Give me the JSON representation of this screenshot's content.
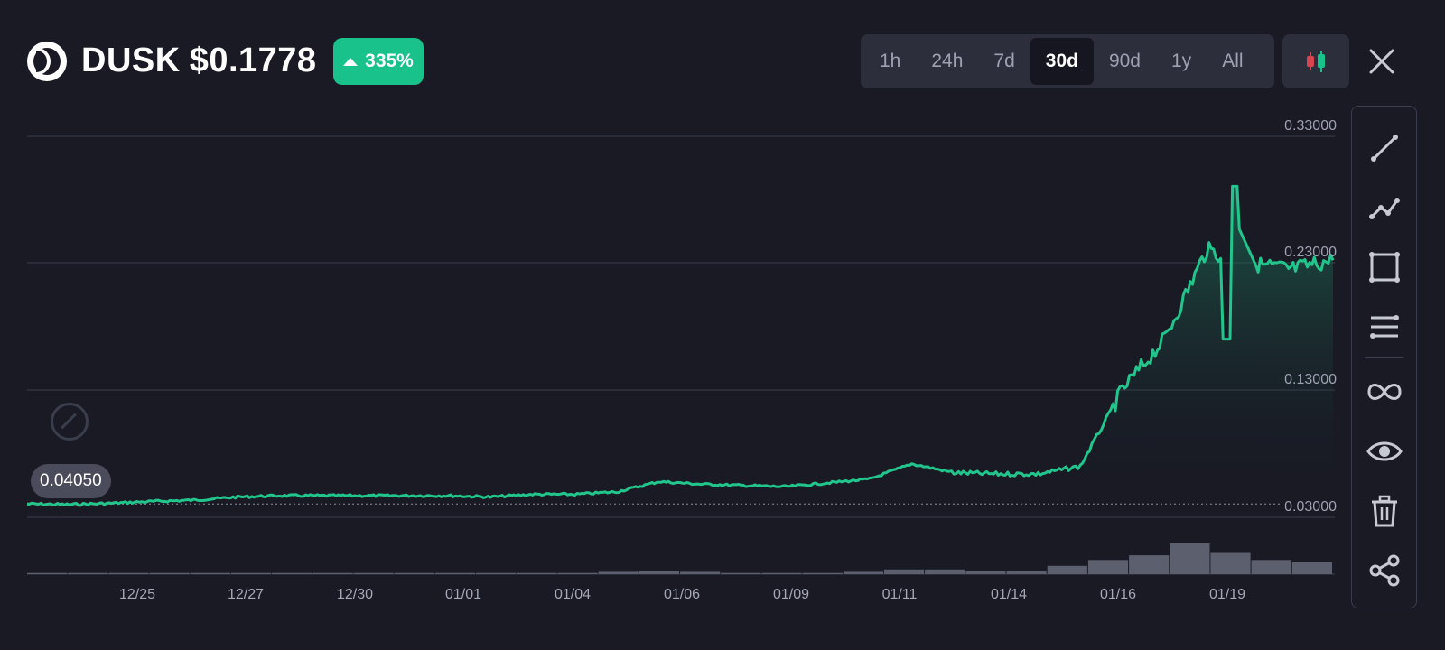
{
  "header": {
    "symbol": "DUSK",
    "price": "$0.1778",
    "change": "335%",
    "logo_icon": "dusk-moon-icon",
    "ranges": [
      {
        "label": "1h"
      },
      {
        "label": "24h"
      },
      {
        "label": "7d"
      },
      {
        "label": "30d",
        "active": true
      },
      {
        "label": "90d"
      },
      {
        "label": "1y"
      },
      {
        "label": "All"
      }
    ],
    "chart_type_icon": "candlestick-icon",
    "close_icon": "close-icon"
  },
  "toolbar": {
    "tools": [
      {
        "name": "trend-line-icon"
      },
      {
        "name": "polyline-icon"
      },
      {
        "name": "rectangle-icon"
      },
      {
        "name": "parallel-lines-icon"
      },
      {
        "name": "infinity-icon"
      },
      {
        "name": "eye-icon"
      },
      {
        "name": "trash-icon"
      },
      {
        "name": "share-icon"
      }
    ]
  },
  "price_tag": "0.04050",
  "colors": {
    "background": "#191a24",
    "up": "#19c28b",
    "line": "#22c58c",
    "down": "#d64550",
    "grid": "#3a3d4d",
    "volume": "#5c5f6e",
    "panel": "#2c2e3c"
  },
  "chart_data": {
    "type": "line",
    "y_ticks": [
      "0.33000",
      "0.23000",
      "0.13000",
      "0.03000"
    ],
    "ylim": [
      0.0,
      0.33
    ],
    "x_tick_labels": [
      "12/25",
      "12/27",
      "12/30",
      "01/01",
      "01/04",
      "01/06",
      "01/09",
      "01/11",
      "01/14",
      "01/16",
      "01/19"
    ],
    "series": [
      {
        "x": [
          "12/22",
          "12/23",
          "12/24",
          "12/25",
          "12/26",
          "12/27",
          "12/28",
          "12/29",
          "12/30",
          "12/31",
          "01/01",
          "01/02",
          "01/03",
          "01/04",
          "01/05",
          "01/06",
          "01/07",
          "01/08",
          "01/09",
          "01/10",
          "01/11",
          "01/12",
          "01/13",
          "01/14",
          "01/15",
          "01/16",
          "01/17",
          "01/18",
          "01/19",
          "01/20",
          "01/21",
          "01/22"
        ],
        "values": [
          0.0405,
          0.04,
          0.041,
          0.0425,
          0.0435,
          0.046,
          0.047,
          0.047,
          0.047,
          0.047,
          0.047,
          0.046,
          0.048,
          0.048,
          0.05,
          0.058,
          0.056,
          0.055,
          0.054,
          0.057,
          0.06,
          0.072,
          0.065,
          0.064,
          0.064,
          0.07,
          0.13,
          0.17,
          0.24,
          0.23,
          0.225,
          0.232
        ]
      }
    ],
    "baseline": 0.0405,
    "volume": [
      1,
      1,
      1,
      1,
      1,
      1,
      1,
      1,
      1,
      1,
      1,
      1,
      1,
      1,
      2,
      3,
      2,
      1,
      1,
      1,
      2,
      4,
      4,
      3,
      3,
      7,
      12,
      16,
      26,
      18,
      12,
      10
    ]
  }
}
